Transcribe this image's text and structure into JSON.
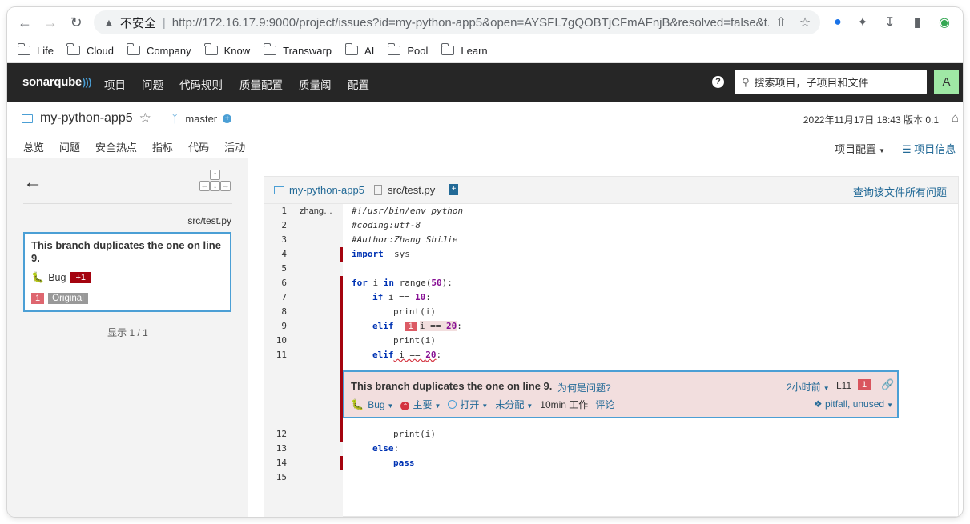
{
  "browser": {
    "insecure_label": "不安全",
    "url": "http://172.16.17.9:9000/project/issues?id=my-python-app5&open=AYSFL7gQOBTjCFmAFnjB&resolved=false&t...",
    "bookmarks": [
      "Life",
      "Cloud",
      "Company",
      "Know",
      "Transwarp",
      "AI",
      "Pool",
      "Learn"
    ]
  },
  "nav": {
    "logo_text": "sonarqube",
    "items": [
      "项目",
      "问题",
      "代码规则",
      "质量配置",
      "质量阈",
      "配置"
    ],
    "search_placeholder": "搜索项目，子项目和文件",
    "avatar_letter": "A",
    "help": "?"
  },
  "project": {
    "name": "my-python-app5",
    "branch": "master",
    "meta": "2022年11月17日 18:43   版本 0.1",
    "tabs": [
      "总览",
      "问题",
      "安全热点",
      "指标",
      "代码",
      "活动"
    ],
    "active_tab": "问题",
    "config_label": "项目配置",
    "info_label": "项目信息"
  },
  "left": {
    "file": "src/test.py",
    "issue": {
      "message": "This branch duplicates the one on line 9.",
      "type": "Bug",
      "badge": "+1",
      "location_num": "1",
      "location_label": "Original"
    },
    "count": "显示 1 / 1"
  },
  "source": {
    "project": "my-python-app5",
    "file": "src/test.py",
    "all_issues_link": "查询该文件所有问题",
    "scm_author": "zhang…",
    "lines": [
      "1",
      "2",
      "3",
      "4",
      "5",
      "6",
      "7",
      "8",
      "9",
      "10",
      "11",
      "12",
      "13",
      "14",
      "15"
    ],
    "code": {
      "l1": "#!/usr/bin/env python",
      "l2": "#coding:utf-8",
      "l3": "#Author:Zhang ShiJie",
      "l4_kw": "import",
      "l4_rest": "  sys",
      "l6_kw1": "for",
      "l6_a": " i ",
      "l6_kw2": "in",
      "l6_b": " range(",
      "l6_num": "50",
      "l6_c": "):",
      "l7_kw": "if",
      "l7_a": " i == ",
      "l7_num": "10",
      "l7_c": ":",
      "l8": "print(i)",
      "l9_kw": "elif",
      "l9_loc": "1",
      "l9_a": "i == ",
      "l9_num": "20",
      "l9_c": ":",
      "l10": "print(i)",
      "l11_kw": "elif",
      "l11_a": " i == ",
      "l11_num": "20",
      "l11_c": ":",
      "l12": "print(i)",
      "l13_kw": "else",
      "l13_c": ":",
      "l14_kw": "pass"
    },
    "issue": {
      "message": "This branch duplicates the one on line 9.",
      "why": "为何是问题?",
      "time": "2小时前",
      "line": "L11",
      "loc": "1",
      "type": "Bug",
      "severity": "主要",
      "status": "打开",
      "assignee": "未分配",
      "effort": "10min 工作",
      "comment": "评论",
      "tags": "pitfall, unused"
    }
  }
}
